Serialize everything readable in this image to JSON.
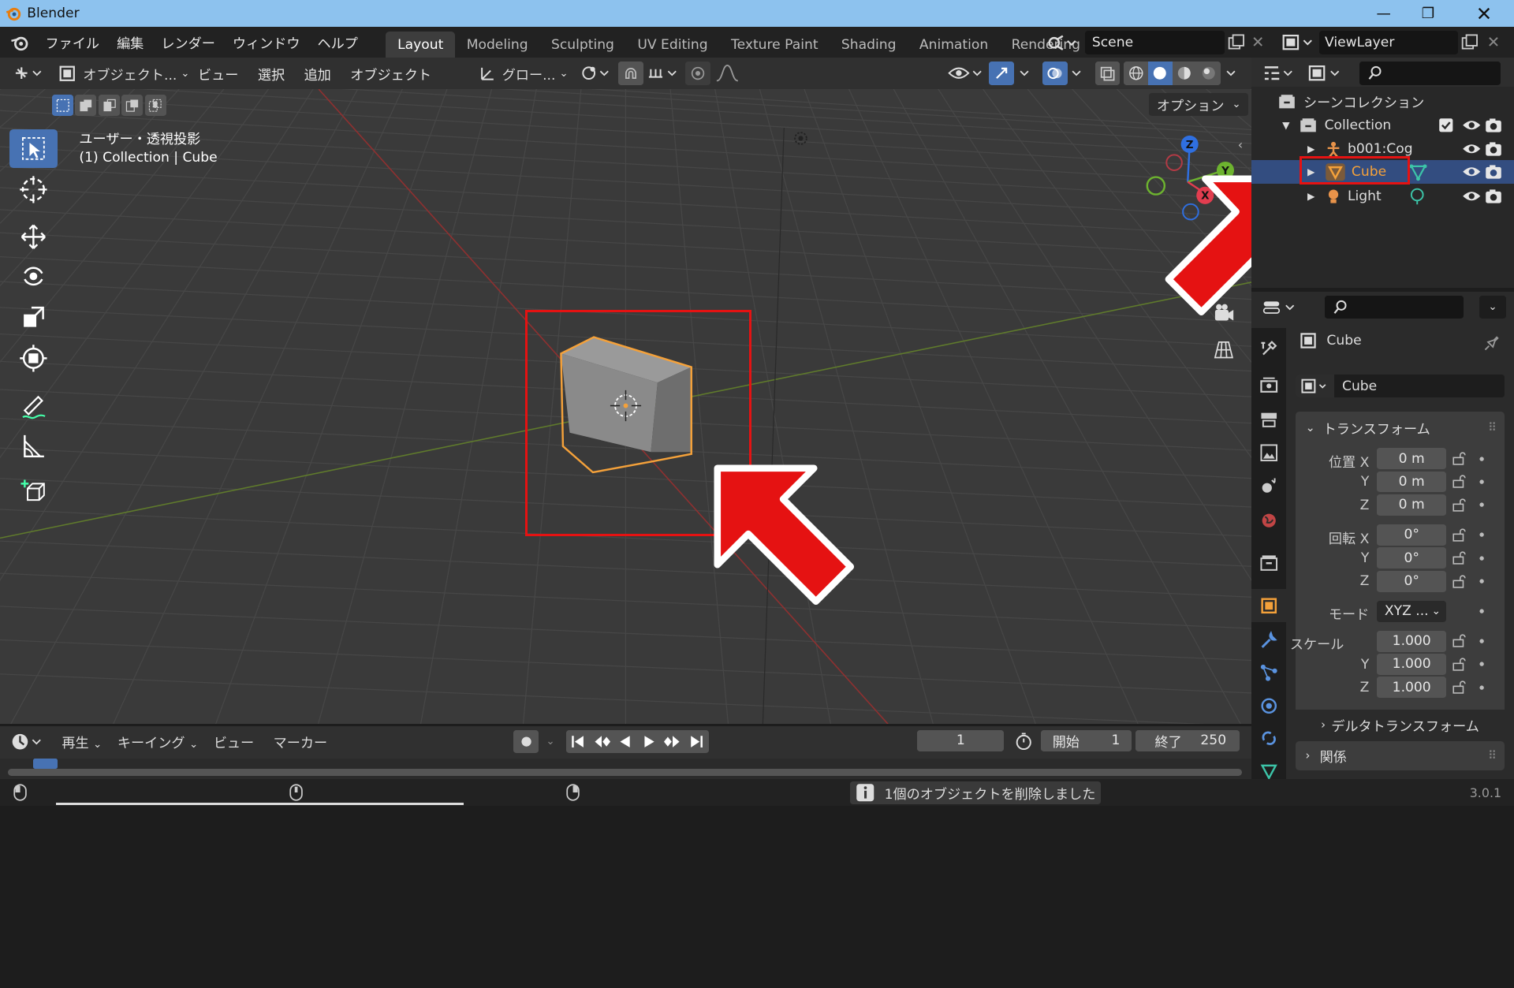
{
  "window": {
    "title": "Blender",
    "version": "3.0.1"
  },
  "menu": [
    "ファイル",
    "編集",
    "レンダー",
    "ウィンドウ",
    "ヘルプ"
  ],
  "workspaces": [
    {
      "label": "Layout",
      "active": true
    },
    {
      "label": "Modeling"
    },
    {
      "label": "Sculpting"
    },
    {
      "label": "UV Editing"
    },
    {
      "label": "Texture Paint"
    },
    {
      "label": "Shading"
    },
    {
      "label": "Animation"
    },
    {
      "label": "Rendering"
    }
  ],
  "scene": {
    "name": "Scene"
  },
  "view_layer": {
    "name": "ViewLayer"
  },
  "viewport_header": {
    "mode": "オブジェクト...",
    "menus": [
      "ビュー",
      "選択",
      "追加",
      "オブジェクト"
    ],
    "transform": "グロー...",
    "options": "オプション"
  },
  "viewport": {
    "view_name": "ユーザー・透視投影",
    "context": "(1) Collection | Cube",
    "gizmo": {
      "x": "X",
      "y": "Y",
      "z": "Z"
    }
  },
  "outliner": {
    "scene_collection": "シーンコレクション",
    "items": [
      {
        "label": "Collection"
      },
      {
        "label": "b001:Cog"
      },
      {
        "label": "Cube",
        "selected": true
      },
      {
        "label": "Light"
      }
    ]
  },
  "properties": {
    "object_name": "Cube",
    "object_field": "Cube",
    "transform_panel": "トランスフォーム",
    "location": {
      "label": "位置 X",
      "x": "0 m",
      "y": "0 m",
      "z": "0 m"
    },
    "rotation": {
      "label": "回転 X",
      "x": "0°",
      "y": "0°",
      "z": "0°"
    },
    "mode": {
      "label": "モード",
      "value": "XYZ ..."
    },
    "scale": {
      "label": "スケール",
      "x": "1.000",
      "y": "1.000",
      "z": "1.000"
    },
    "axis_y": "Y",
    "axis_z": "Z",
    "delta_panel": "デルタトランスフォーム",
    "relations_panel": "関係"
  },
  "timeline": {
    "menus": [
      "再生",
      "キーイング",
      "ビュー",
      "マーカー"
    ],
    "current_frame": "1",
    "start_label": "開始",
    "start": "1",
    "end_label": "終了",
    "end": "250"
  },
  "status": {
    "message": "1個のオブジェクトを削除しました"
  },
  "colors": {
    "accent": "#4772b3",
    "highlight": "#e51212",
    "selected": "#f4a13a"
  }
}
